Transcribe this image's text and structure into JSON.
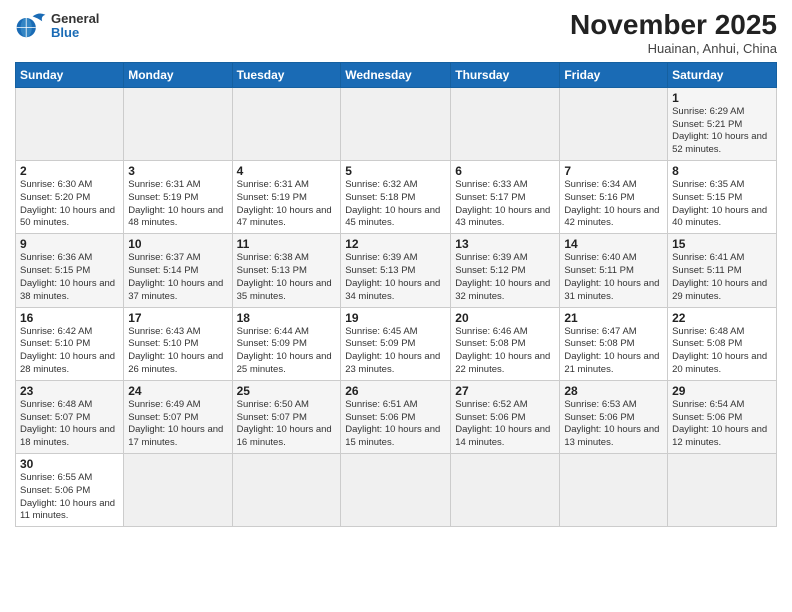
{
  "header": {
    "logo_general": "General",
    "logo_blue": "Blue",
    "month_title": "November 2025",
    "location": "Huainan, Anhui, China"
  },
  "weekdays": [
    "Sunday",
    "Monday",
    "Tuesday",
    "Wednesday",
    "Thursday",
    "Friday",
    "Saturday"
  ],
  "weeks": [
    [
      {
        "day": "",
        "sunrise": "",
        "sunset": "",
        "daylight": ""
      },
      {
        "day": "",
        "sunrise": "",
        "sunset": "",
        "daylight": ""
      },
      {
        "day": "",
        "sunrise": "",
        "sunset": "",
        "daylight": ""
      },
      {
        "day": "",
        "sunrise": "",
        "sunset": "",
        "daylight": ""
      },
      {
        "day": "",
        "sunrise": "",
        "sunset": "",
        "daylight": ""
      },
      {
        "day": "",
        "sunrise": "",
        "sunset": "",
        "daylight": ""
      },
      {
        "day": "1",
        "sunrise": "Sunrise: 6:29 AM",
        "sunset": "Sunset: 5:21 PM",
        "daylight": "Daylight: 10 hours and 52 minutes."
      }
    ],
    [
      {
        "day": "2",
        "sunrise": "Sunrise: 6:30 AM",
        "sunset": "Sunset: 5:20 PM",
        "daylight": "Daylight: 10 hours and 50 minutes."
      },
      {
        "day": "3",
        "sunrise": "Sunrise: 6:31 AM",
        "sunset": "Sunset: 5:19 PM",
        "daylight": "Daylight: 10 hours and 48 minutes."
      },
      {
        "day": "4",
        "sunrise": "Sunrise: 6:31 AM",
        "sunset": "Sunset: 5:19 PM",
        "daylight": "Daylight: 10 hours and 47 minutes."
      },
      {
        "day": "5",
        "sunrise": "Sunrise: 6:32 AM",
        "sunset": "Sunset: 5:18 PM",
        "daylight": "Daylight: 10 hours and 45 minutes."
      },
      {
        "day": "6",
        "sunrise": "Sunrise: 6:33 AM",
        "sunset": "Sunset: 5:17 PM",
        "daylight": "Daylight: 10 hours and 43 minutes."
      },
      {
        "day": "7",
        "sunrise": "Sunrise: 6:34 AM",
        "sunset": "Sunset: 5:16 PM",
        "daylight": "Daylight: 10 hours and 42 minutes."
      },
      {
        "day": "8",
        "sunrise": "Sunrise: 6:35 AM",
        "sunset": "Sunset: 5:15 PM",
        "daylight": "Daylight: 10 hours and 40 minutes."
      }
    ],
    [
      {
        "day": "9",
        "sunrise": "Sunrise: 6:36 AM",
        "sunset": "Sunset: 5:15 PM",
        "daylight": "Daylight: 10 hours and 38 minutes."
      },
      {
        "day": "10",
        "sunrise": "Sunrise: 6:37 AM",
        "sunset": "Sunset: 5:14 PM",
        "daylight": "Daylight: 10 hours and 37 minutes."
      },
      {
        "day": "11",
        "sunrise": "Sunrise: 6:38 AM",
        "sunset": "Sunset: 5:13 PM",
        "daylight": "Daylight: 10 hours and 35 minutes."
      },
      {
        "day": "12",
        "sunrise": "Sunrise: 6:39 AM",
        "sunset": "Sunset: 5:13 PM",
        "daylight": "Daylight: 10 hours and 34 minutes."
      },
      {
        "day": "13",
        "sunrise": "Sunrise: 6:39 AM",
        "sunset": "Sunset: 5:12 PM",
        "daylight": "Daylight: 10 hours and 32 minutes."
      },
      {
        "day": "14",
        "sunrise": "Sunrise: 6:40 AM",
        "sunset": "Sunset: 5:11 PM",
        "daylight": "Daylight: 10 hours and 31 minutes."
      },
      {
        "day": "15",
        "sunrise": "Sunrise: 6:41 AM",
        "sunset": "Sunset: 5:11 PM",
        "daylight": "Daylight: 10 hours and 29 minutes."
      }
    ],
    [
      {
        "day": "16",
        "sunrise": "Sunrise: 6:42 AM",
        "sunset": "Sunset: 5:10 PM",
        "daylight": "Daylight: 10 hours and 28 minutes."
      },
      {
        "day": "17",
        "sunrise": "Sunrise: 6:43 AM",
        "sunset": "Sunset: 5:10 PM",
        "daylight": "Daylight: 10 hours and 26 minutes."
      },
      {
        "day": "18",
        "sunrise": "Sunrise: 6:44 AM",
        "sunset": "Sunset: 5:09 PM",
        "daylight": "Daylight: 10 hours and 25 minutes."
      },
      {
        "day": "19",
        "sunrise": "Sunrise: 6:45 AM",
        "sunset": "Sunset: 5:09 PM",
        "daylight": "Daylight: 10 hours and 23 minutes."
      },
      {
        "day": "20",
        "sunrise": "Sunrise: 6:46 AM",
        "sunset": "Sunset: 5:08 PM",
        "daylight": "Daylight: 10 hours and 22 minutes."
      },
      {
        "day": "21",
        "sunrise": "Sunrise: 6:47 AM",
        "sunset": "Sunset: 5:08 PM",
        "daylight": "Daylight: 10 hours and 21 minutes."
      },
      {
        "day": "22",
        "sunrise": "Sunrise: 6:48 AM",
        "sunset": "Sunset: 5:08 PM",
        "daylight": "Daylight: 10 hours and 20 minutes."
      }
    ],
    [
      {
        "day": "23",
        "sunrise": "Sunrise: 6:48 AM",
        "sunset": "Sunset: 5:07 PM",
        "daylight": "Daylight: 10 hours and 18 minutes."
      },
      {
        "day": "24",
        "sunrise": "Sunrise: 6:49 AM",
        "sunset": "Sunset: 5:07 PM",
        "daylight": "Daylight: 10 hours and 17 minutes."
      },
      {
        "day": "25",
        "sunrise": "Sunrise: 6:50 AM",
        "sunset": "Sunset: 5:07 PM",
        "daylight": "Daylight: 10 hours and 16 minutes."
      },
      {
        "day": "26",
        "sunrise": "Sunrise: 6:51 AM",
        "sunset": "Sunset: 5:06 PM",
        "daylight": "Daylight: 10 hours and 15 minutes."
      },
      {
        "day": "27",
        "sunrise": "Sunrise: 6:52 AM",
        "sunset": "Sunset: 5:06 PM",
        "daylight": "Daylight: 10 hours and 14 minutes."
      },
      {
        "day": "28",
        "sunrise": "Sunrise: 6:53 AM",
        "sunset": "Sunset: 5:06 PM",
        "daylight": "Daylight: 10 hours and 13 minutes."
      },
      {
        "day": "29",
        "sunrise": "Sunrise: 6:54 AM",
        "sunset": "Sunset: 5:06 PM",
        "daylight": "Daylight: 10 hours and 12 minutes."
      }
    ],
    [
      {
        "day": "30",
        "sunrise": "Sunrise: 6:55 AM",
        "sunset": "Sunset: 5:06 PM",
        "daylight": "Daylight: 10 hours and 11 minutes."
      },
      {
        "day": "",
        "sunrise": "",
        "sunset": "",
        "daylight": ""
      },
      {
        "day": "",
        "sunrise": "",
        "sunset": "",
        "daylight": ""
      },
      {
        "day": "",
        "sunrise": "",
        "sunset": "",
        "daylight": ""
      },
      {
        "day": "",
        "sunrise": "",
        "sunset": "",
        "daylight": ""
      },
      {
        "day": "",
        "sunrise": "",
        "sunset": "",
        "daylight": ""
      },
      {
        "day": "",
        "sunrise": "",
        "sunset": "",
        "daylight": ""
      }
    ]
  ]
}
